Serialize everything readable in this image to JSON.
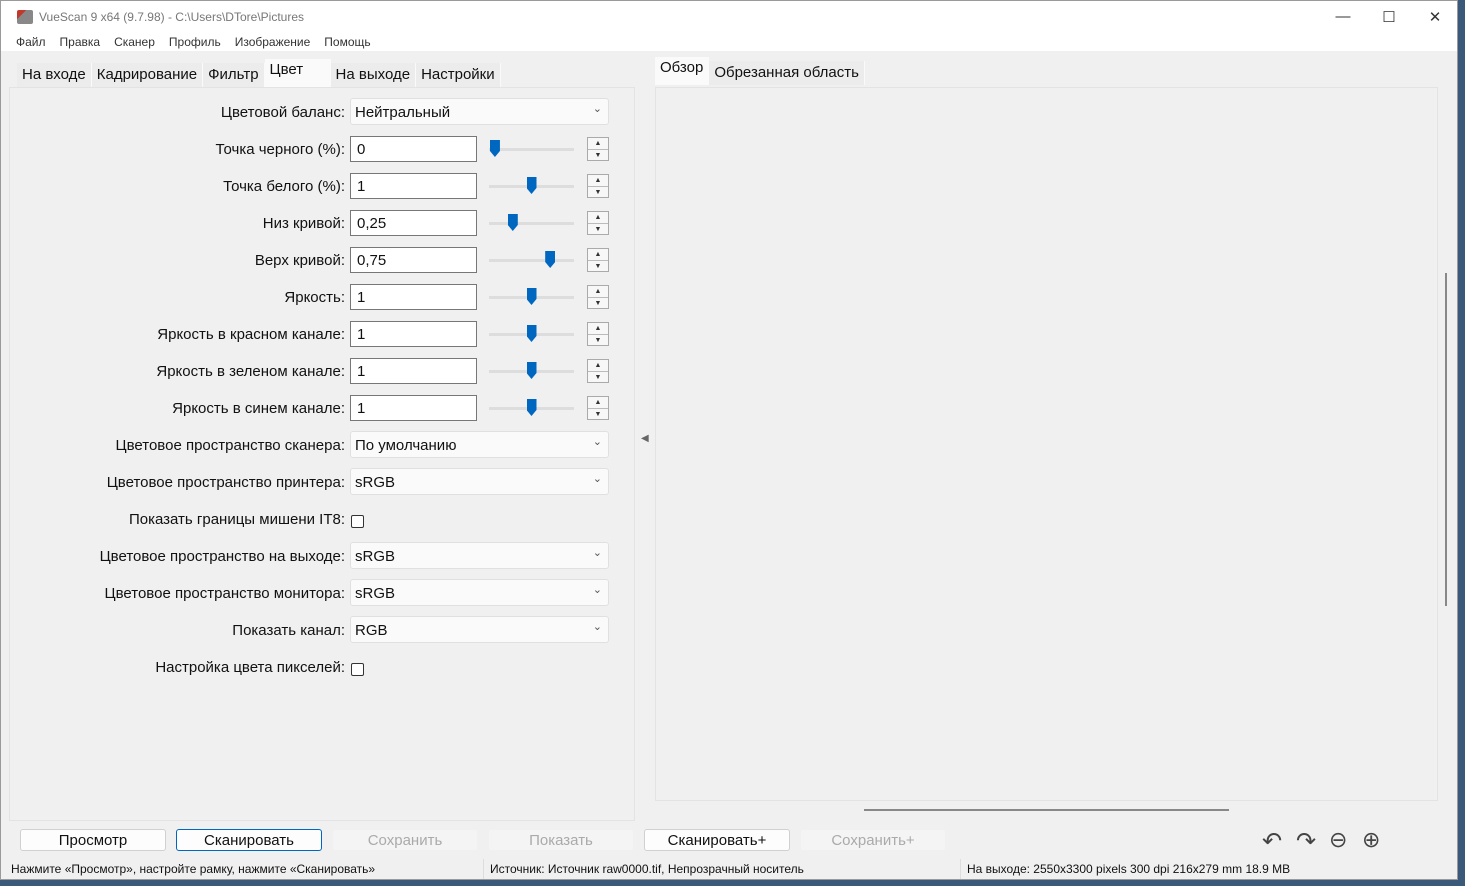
{
  "window": {
    "title": "VueScan 9 x64 (9.7.98) - C:\\Users\\DTore\\Pictures",
    "minimize": "—",
    "maximize": "☐",
    "close": "✕"
  },
  "menu": [
    "Файл",
    "Правка",
    "Сканер",
    "Профиль",
    "Изображение",
    "Помощь"
  ],
  "left_tabs": [
    "На входе",
    "Кадрирование",
    "Фильтр",
    "Цвет",
    "На выходе",
    "Настройки"
  ],
  "active_left_tab": 3,
  "right_tabs": [
    "Обзор",
    "Обрезанная область"
  ],
  "rows": [
    {
      "type": "combo",
      "label": "Цветовой баланс:",
      "value": "Нейтральный"
    },
    {
      "type": "num",
      "label": "Точка черного (%):",
      "value": "0",
      "slider": 0.07
    },
    {
      "type": "num",
      "label": "Точка белого (%):",
      "value": "1",
      "slider": 0.5
    },
    {
      "type": "num",
      "label": "Низ кривой:",
      "value": "0,25",
      "slider": 0.28
    },
    {
      "type": "num",
      "label": "Верх кривой:",
      "value": "0,75",
      "slider": 0.72
    },
    {
      "type": "num",
      "label": "Яркость:",
      "value": "1",
      "slider": 0.5
    },
    {
      "type": "num",
      "label": "Яркость в красном канале:",
      "value": "1",
      "slider": 0.5
    },
    {
      "type": "num",
      "label": "Яркость в зеленом канале:",
      "value": "1",
      "slider": 0.5
    },
    {
      "type": "num",
      "label": "Яркость в синем канале:",
      "value": "1",
      "slider": 0.5
    },
    {
      "type": "combo",
      "label": "Цветовое пространство сканера:",
      "value": "По умолчанию"
    },
    {
      "type": "combo",
      "label": "Цветовое пространство принтера:",
      "value": "sRGB"
    },
    {
      "type": "check",
      "label": "Показать границы мишени IT8:",
      "checked": false
    },
    {
      "type": "combo",
      "label": "Цветовое пространство на выходе:",
      "value": "sRGB"
    },
    {
      "type": "combo",
      "label": "Цветовое пространство монитора:",
      "value": "sRGB"
    },
    {
      "type": "combo",
      "label": "Показать канал:",
      "value": "RGB"
    },
    {
      "type": "check",
      "label": "Настройка цвета пикселей:",
      "checked": false
    }
  ],
  "buttons": {
    "preview": "Просмотр",
    "scan": "Сканировать",
    "save": "Сохранить",
    "show": "Показать",
    "scan_plus": "Сканировать+",
    "save_plus": "Сохранить+"
  },
  "status": {
    "hint": "Нажмите «Просмотр», настройте рамку, нажмите «Сканировать»",
    "source": "Источник: Источник raw0000.tif, Непрозрачный носитель",
    "output": "На выходе: 2550x3300 pixels 300 dpi 216x279 mm 18.9 MB"
  }
}
